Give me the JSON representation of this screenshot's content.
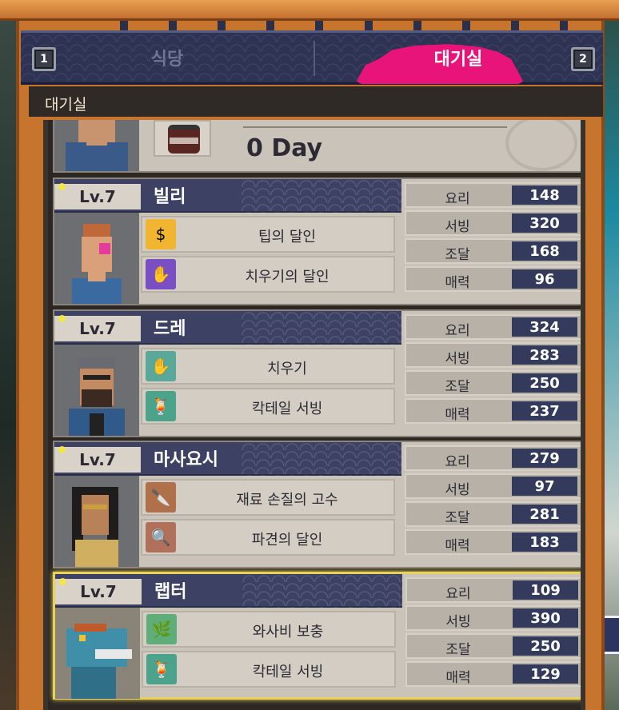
{
  "tabs": {
    "left_key": "1",
    "right_key": "2",
    "items": [
      {
        "label": "식당",
        "active": false
      },
      {
        "label": "대기실",
        "active": true
      }
    ]
  },
  "section_title": "대기실",
  "partial_card": {
    "day_text": "0 Day"
  },
  "characters": [
    {
      "level": "Lv.7",
      "name": "빌리",
      "skills": [
        {
          "name": "팁의 달인",
          "icon": "coin-icon"
        },
        {
          "name": "치우기의 달인",
          "icon": "cleaning-hand-icon"
        }
      ],
      "stats": [
        {
          "label": "요리",
          "value": "148"
        },
        {
          "label": "서빙",
          "value": "320"
        },
        {
          "label": "조달",
          "value": "168"
        },
        {
          "label": "매력",
          "value": "96"
        }
      ],
      "selected": false
    },
    {
      "level": "Lv.7",
      "name": "드레",
      "skills": [
        {
          "name": "치우기",
          "icon": "cleaning-hand-icon"
        },
        {
          "name": "칵테일 서빙",
          "icon": "cocktail-icon"
        }
      ],
      "stats": [
        {
          "label": "요리",
          "value": "324"
        },
        {
          "label": "서빙",
          "value": "283"
        },
        {
          "label": "조달",
          "value": "250"
        },
        {
          "label": "매력",
          "value": "237"
        }
      ],
      "selected": false
    },
    {
      "level": "Lv.7",
      "name": "마사요시",
      "skills": [
        {
          "name": "재료 손질의 고수",
          "icon": "knife-board-icon"
        },
        {
          "name": "파견의 달인",
          "icon": "magnifier-icon"
        }
      ],
      "stats": [
        {
          "label": "요리",
          "value": "279"
        },
        {
          "label": "서빙",
          "value": "97"
        },
        {
          "label": "조달",
          "value": "281"
        },
        {
          "label": "매력",
          "value": "183"
        }
      ],
      "selected": false
    },
    {
      "level": "Lv.7",
      "name": "랩터",
      "skills": [
        {
          "name": "와사비 보충",
          "icon": "wasabi-icon"
        },
        {
          "name": "칵테일 서빙",
          "icon": "cocktail-icon"
        }
      ],
      "stats": [
        {
          "label": "요리",
          "value": "109"
        },
        {
          "label": "서빙",
          "value": "390"
        },
        {
          "label": "조달",
          "value": "250"
        },
        {
          "label": "매력",
          "value": "129"
        }
      ],
      "selected": true
    }
  ]
}
